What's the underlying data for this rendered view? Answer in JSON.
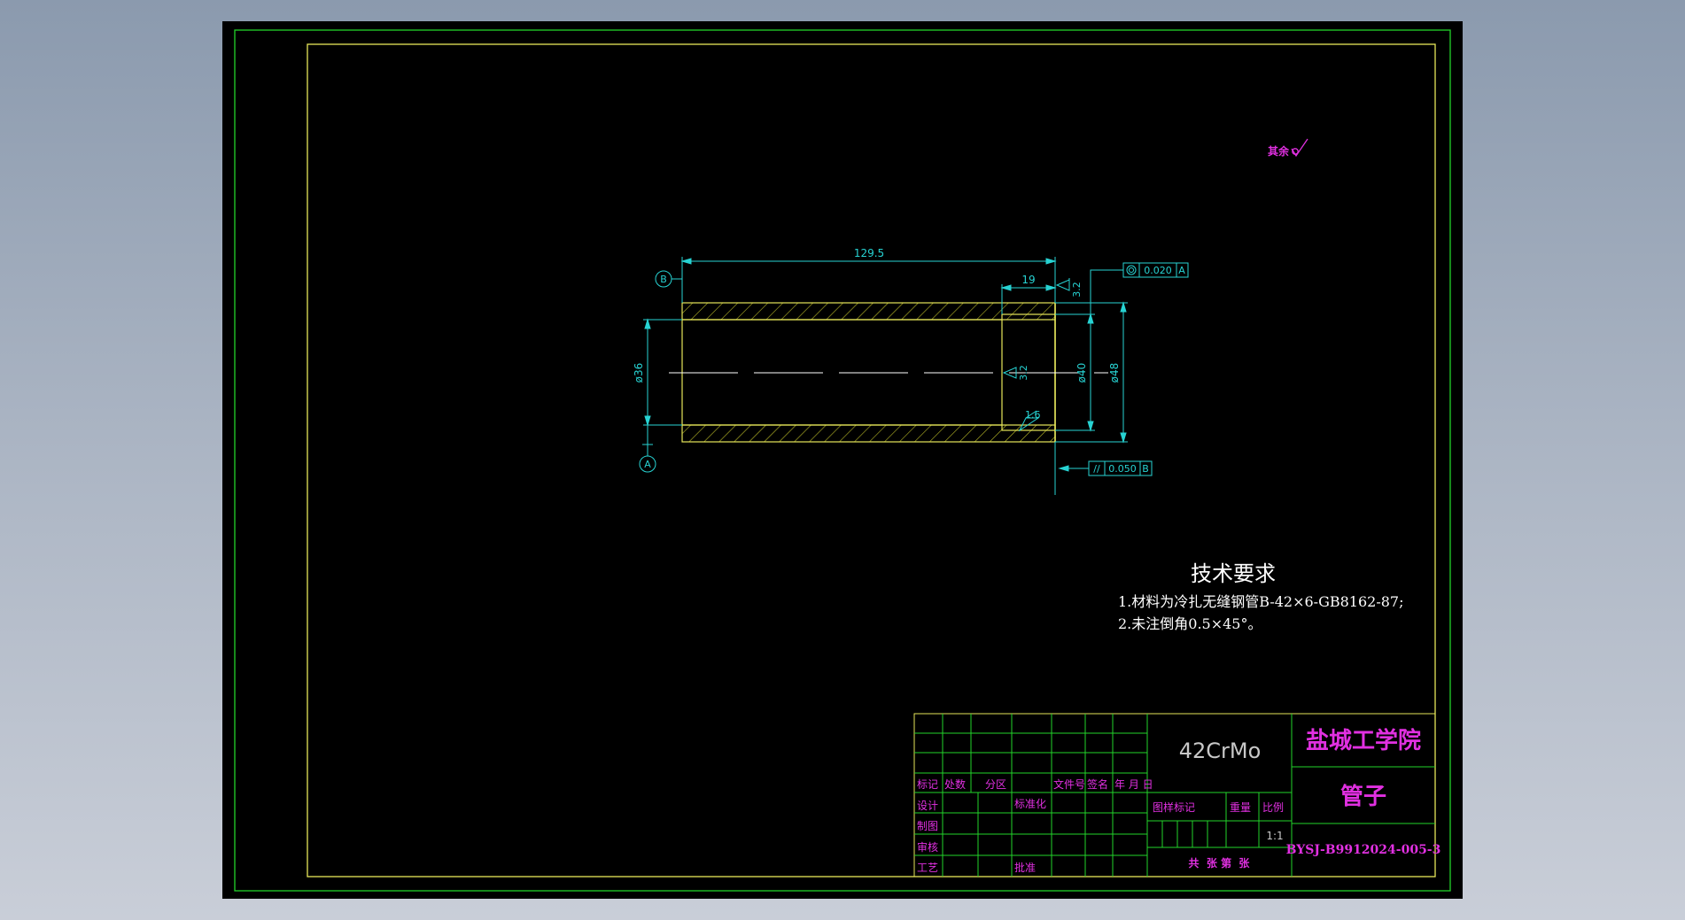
{
  "colors": {
    "background": "#000000",
    "border_outer": "#22d32a",
    "border_inner": "#e6e65a",
    "dimension": "#27d3d3",
    "hatch": "#b8b827",
    "part_outline": "#e6e65a",
    "annotation": "#e130e1",
    "table_line": "#22d32a",
    "text_white": "#ffffff",
    "table_text_gray": "#c8c8c8"
  },
  "surface_note": {
    "label": "其余"
  },
  "dimensions": {
    "length_total": "129.5",
    "length_bore": "19",
    "dia_inner": "ø36",
    "dia_bore": "ø40",
    "dia_outer": "ø48",
    "rough_end": "3.2",
    "rough_bore": "3.2",
    "rough_shoulder": "1.6"
  },
  "datums": {
    "a": "A",
    "b": "B"
  },
  "tolerances": {
    "concentricity": {
      "symbol": "◎",
      "value": "0.020",
      "datum": "A"
    },
    "parallelism": {
      "symbol": "//",
      "value": "0.050",
      "datum": "B"
    }
  },
  "tech_requirements": {
    "title": "技术要求",
    "items": [
      "1.材料为冷扎无缝钢管B-42×6-GB8162-87;",
      "2.未注倒角0.5×45°。"
    ]
  },
  "title_block": {
    "material": "42CrMo",
    "school": "盐城工学院",
    "part_name": "管子",
    "drawing_no": "BYSJ-B9912024-005-3",
    "scale": "1:1",
    "headers": {
      "mark": "标记",
      "count": "处数",
      "zone": "分区",
      "doc_no": "文件号",
      "signature": "签名",
      "date": "年 月 日"
    },
    "roles": {
      "design": "设计",
      "drafting": "制图",
      "review": "审核",
      "process": "工艺",
      "standardization": "标准化",
      "approval": "批准"
    },
    "labels": {
      "stage_mark": "图样标记",
      "weight": "重量",
      "scale_label": "比例",
      "sheets": "共  张 第  张"
    }
  }
}
